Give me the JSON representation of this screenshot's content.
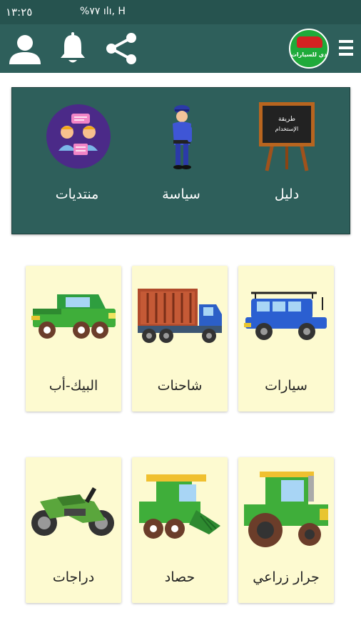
{
  "status_bar": {
    "time": "١٣:٢٥",
    "battery": "%٧٧",
    "signal_icons": "ılı, H"
  },
  "app_bar": {
    "logo_text": "دي للسيارات",
    "icons": [
      "person-icon",
      "bell-icon",
      "share-icon",
      "menu-icon"
    ]
  },
  "top_panel": {
    "items": [
      {
        "label": "دليل",
        "board_text": "طريقة الإستخدام"
      },
      {
        "label": "سياسة"
      },
      {
        "label": "منتديات"
      }
    ]
  },
  "categories": [
    {
      "label": "سيارات"
    },
    {
      "label": "شاحنات"
    },
    {
      "label": "البيك-أب"
    },
    {
      "label": "جرار زراعي"
    },
    {
      "label": "حصاد"
    },
    {
      "label": "دراجات"
    }
  ],
  "colors": {
    "status_bar": "#26534f",
    "app_bar": "#2e5f5b",
    "panel": "#2e5f5b",
    "card": "#fdfad0"
  }
}
